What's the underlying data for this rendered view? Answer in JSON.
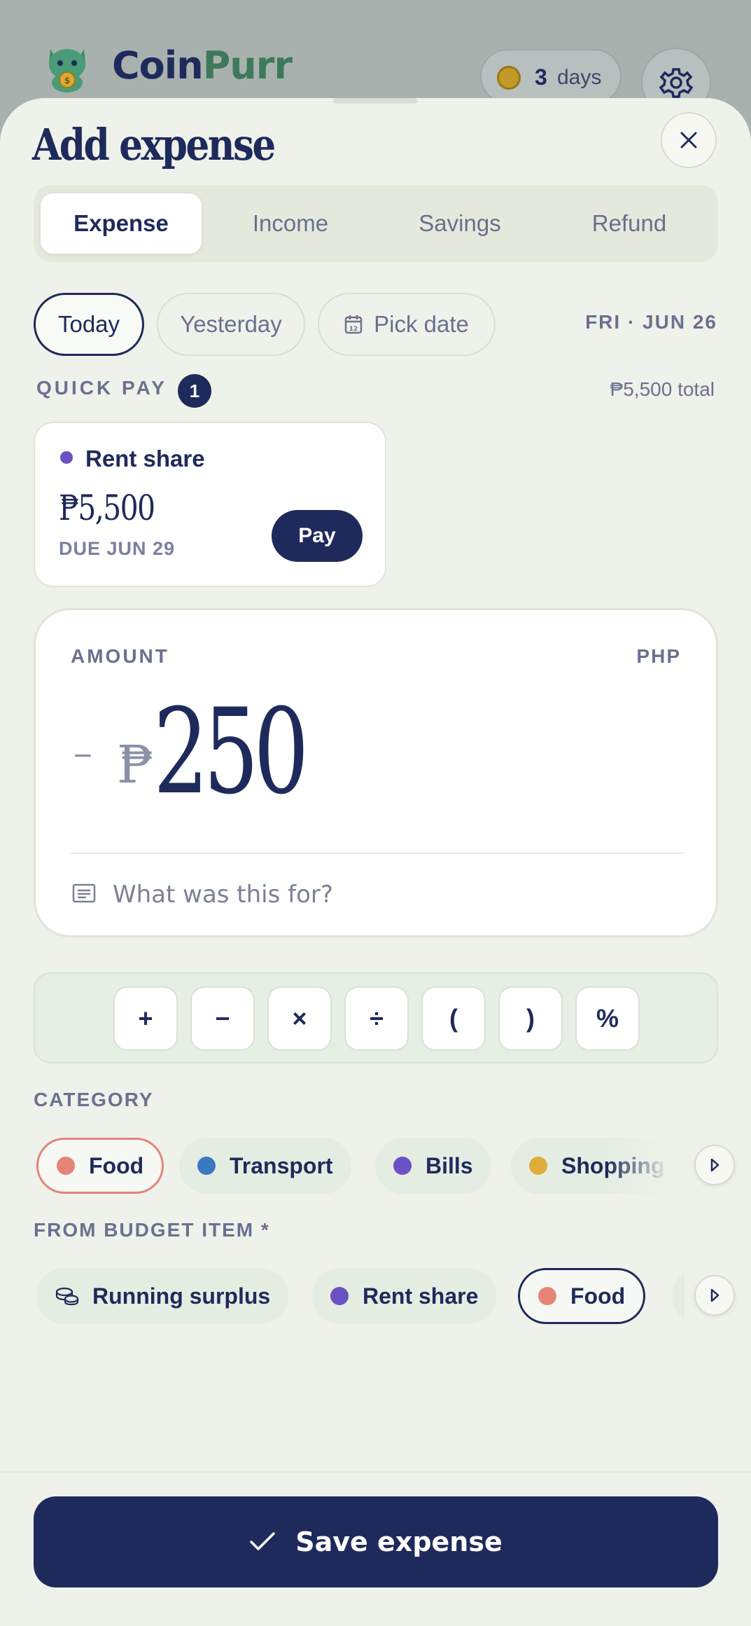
{
  "app": {
    "brand_first": "Coin",
    "brand_second": "Purr",
    "brand_color_primary": "#1f2a5c",
    "brand_color_secondary": "#3d7a5c",
    "logo_icon": "cat-coin-mascot-icon",
    "streak_count": "3",
    "streak_label": "days",
    "streak_icon": "coin-icon",
    "settings_icon": "gear-icon"
  },
  "sheet": {
    "title": "Add expense",
    "close_icon": "close-icon"
  },
  "type_tabs": [
    {
      "label": "Expense",
      "active": true
    },
    {
      "label": "Income",
      "active": false
    },
    {
      "label": "Savings",
      "active": false
    },
    {
      "label": "Refund",
      "active": false
    }
  ],
  "date": {
    "options": [
      {
        "label": "Today",
        "active": true
      },
      {
        "label": "Yesterday",
        "active": false
      },
      {
        "label": "Pick date",
        "active": false,
        "icon": "calendar-icon"
      }
    ],
    "selected_display": "FRI · JUN 26"
  },
  "quick_pay": {
    "label": "QUICK PAY",
    "count": "1",
    "total": "₱5,500 total",
    "items": [
      {
        "name": "Rent share",
        "amount": "₱5,500",
        "due": "DUE JUN 29",
        "button": "Pay",
        "color": "#6a52c4"
      }
    ]
  },
  "amount": {
    "label": "AMOUNT",
    "currency": "PHP",
    "sign": "−",
    "symbol": "₱",
    "value": "250",
    "note_placeholder": "What was this for?",
    "note_icon": "receipt-icon"
  },
  "calculator_keys": [
    "+",
    "−",
    "×",
    "÷",
    "(",
    ")",
    "%"
  ],
  "category": {
    "label": "CATEGORY",
    "items": [
      {
        "label": "Food",
        "color": "#e58477",
        "selected": true
      },
      {
        "label": "Transport",
        "color": "#3a78c0",
        "selected": false
      },
      {
        "label": "Bills",
        "color": "#6a52c4",
        "selected": false
      },
      {
        "label": "Shopping",
        "color": "#e0ad3a",
        "selected": false
      }
    ],
    "scroll_icon": "chevron-right-icon"
  },
  "budget_item": {
    "label": "FROM BUDGET ITEM *",
    "items": [
      {
        "label": "Running surplus",
        "icon": "coins-stack-icon",
        "selected": false
      },
      {
        "label": "Rent share",
        "color": "#6a52c4",
        "selected": false
      },
      {
        "label": "Food",
        "color": "#e58477",
        "selected": true
      }
    ],
    "scroll_icon": "chevron-right-icon"
  },
  "save": {
    "label": "Save expense",
    "icon": "check-icon"
  }
}
